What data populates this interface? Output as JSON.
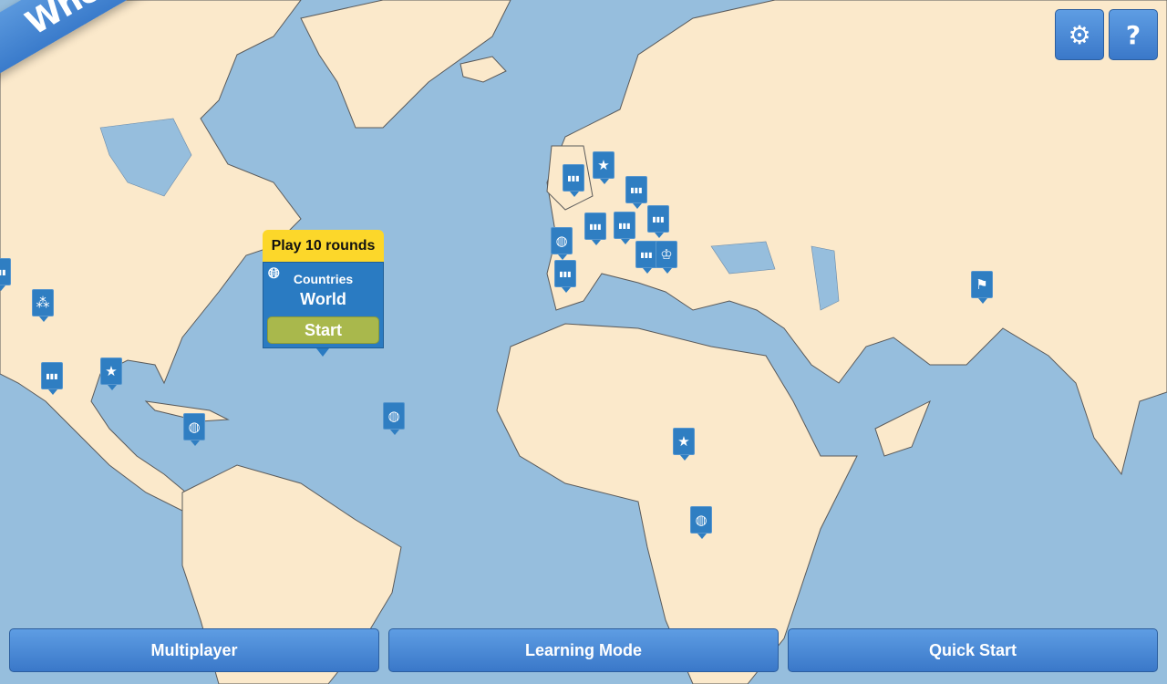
{
  "app": {
    "title": "Where is that?"
  },
  "toolbar": {
    "settings_icon": "gears-icon",
    "help_label": "?"
  },
  "popup": {
    "header": "Play 10 rounds",
    "icon": "globe-icon",
    "category": "Countries",
    "region": "World",
    "start_label": "Start"
  },
  "bottom_buttons": [
    {
      "label": "Multiplayer"
    },
    {
      "label": "Learning Mode"
    },
    {
      "label": "Quick Start"
    }
  ],
  "markers": [
    {
      "type": "bars"
    },
    {
      "type": "star"
    },
    {
      "type": "bars"
    },
    {
      "type": "bars"
    },
    {
      "type": "bars"
    },
    {
      "type": "bars"
    },
    {
      "type": "globe"
    },
    {
      "type": "bars"
    },
    {
      "type": "bars"
    },
    {
      "type": "trophy"
    },
    {
      "type": "flag"
    },
    {
      "type": "stars"
    },
    {
      "type": "bars"
    },
    {
      "type": "star"
    },
    {
      "type": "globe"
    },
    {
      "type": "globe"
    },
    {
      "type": "star"
    },
    {
      "type": "globe"
    },
    {
      "type": "bars"
    }
  ],
  "colors": {
    "ocean": "#96bedd",
    "land": "#fbe9cb",
    "accent": "#3a7bcb",
    "popup_header": "#fcd72a",
    "start": "#a9b84c"
  }
}
